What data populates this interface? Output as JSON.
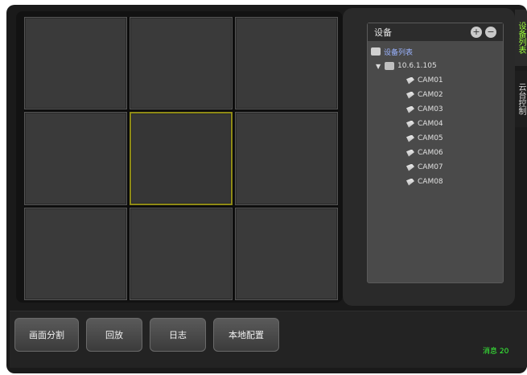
{
  "right_panel": {
    "device_title": "设备",
    "buttons": {
      "add": "+",
      "remove": "−"
    },
    "tree": {
      "root_label": "设备列表",
      "server_label": "10.6.1.105",
      "cameras": [
        "CAM01",
        "CAM02",
        "CAM03",
        "CAM04",
        "CAM05",
        "CAM06",
        "CAM07",
        "CAM08"
      ]
    }
  },
  "side_tabs": {
    "device_tab": "设备列表",
    "ptz_tab": "云台控制"
  },
  "toolbar": {
    "split_label": "画面分割",
    "playback_label": "回放",
    "log_label": "日志",
    "config_label": "本地配置"
  },
  "status": {
    "message_label": "消息 20"
  },
  "colors": {
    "accent_green": "#39ff39",
    "selection_border": "#8f8a16",
    "background": "#1a1a1a"
  },
  "icons": {
    "device_root": "device-list-icon",
    "server": "server-icon",
    "camera": "camera-icon"
  }
}
